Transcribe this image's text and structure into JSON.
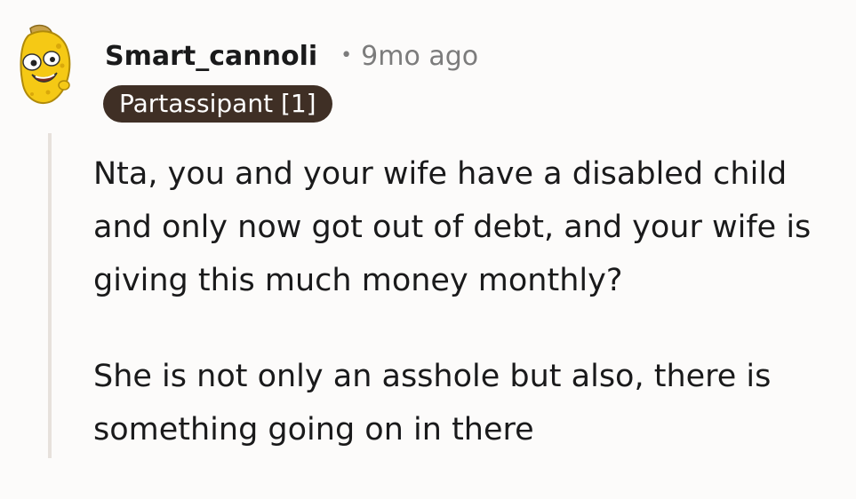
{
  "comment": {
    "author": "Smart_cannoli",
    "separator": "•",
    "timestamp": "9mo ago",
    "flair": "Partassipant [1]",
    "avatar_icon": "cannoli-avatar-icon",
    "paragraphs": [
      "Nta, you and your wife have a disabled child and only now got out of debt, and your wife is giving this much money monthly?",
      "She is not only an asshole but also, there is something going on in there"
    ]
  },
  "colors": {
    "background": "#fcfbfa",
    "text": "#1a1a1b",
    "meta": "#7c7c7c",
    "flair_bg": "#3f2f25",
    "flair_text": "#ffffff",
    "thread_line": "#e7e1dc",
    "avatar_yellow": "#f5c915"
  }
}
